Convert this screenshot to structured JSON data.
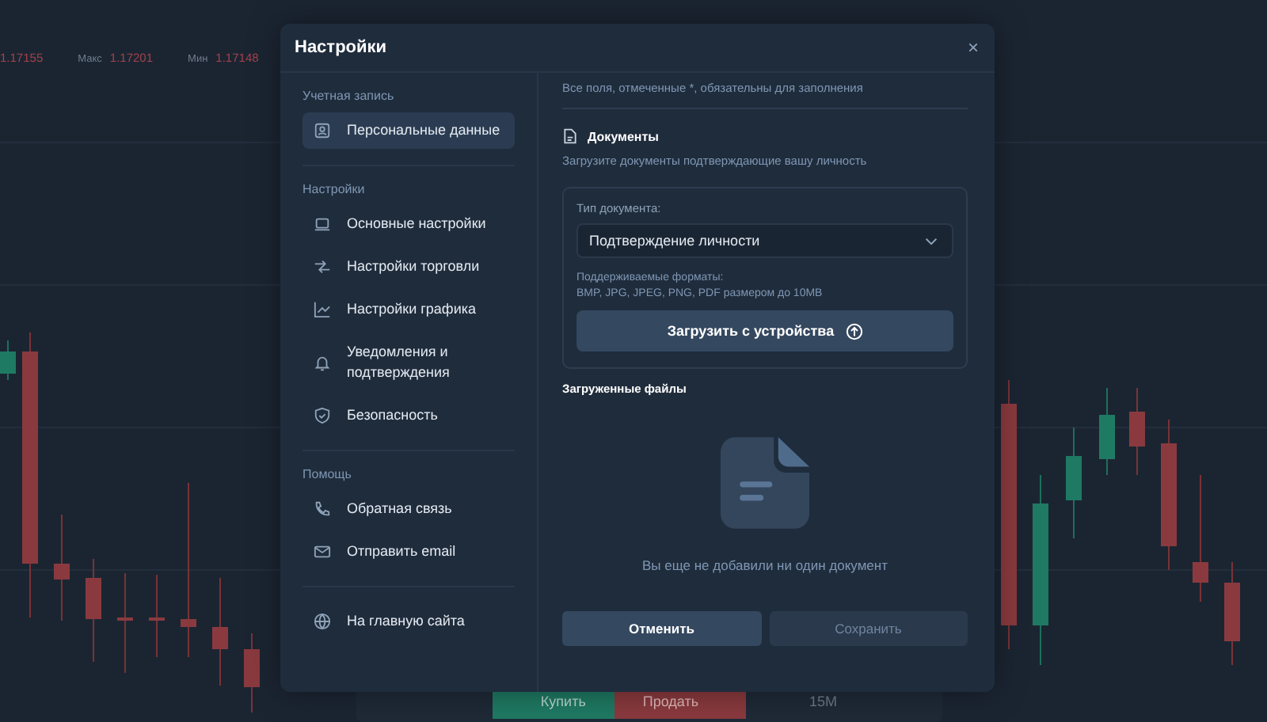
{
  "chart_header": {
    "stats": [
      {
        "value": "1.17155"
      },
      {
        "label": "Макс",
        "value": "1.17201"
      },
      {
        "label": "Мин",
        "value": "1.17148"
      }
    ]
  },
  "trade_bar": {
    "buy": "Купить",
    "sell": "Продать",
    "timeframe": "15М"
  },
  "window": {
    "title": "Настройки",
    "close": "×"
  },
  "sidebar": {
    "sections": [
      {
        "title": "Учетная запись",
        "items": [
          {
            "label": "Персональные данные",
            "selected": true
          }
        ]
      },
      {
        "title": "Настройки",
        "items": [
          {
            "label": "Основные настройки",
            "selected": false
          },
          {
            "label": "Настройки торговли",
            "selected": false
          },
          {
            "label": "Настройки графика",
            "selected": false
          },
          {
            "label": "Уведомления и подтверждения",
            "selected": false
          },
          {
            "label": "Безопасность",
            "selected": false
          }
        ]
      },
      {
        "title": "Помощь",
        "items": [
          {
            "label": "Обратная связь",
            "selected": false
          },
          {
            "label": "Отправить email",
            "selected": false
          }
        ]
      },
      {
        "items": [
          {
            "label": "На главную сайта",
            "selected": false
          }
        ]
      }
    ]
  },
  "content": {
    "note": "Все поля, отмеченные *, обязательны для заполнения",
    "documents": {
      "title": "Документы",
      "subtitle": "Загрузите документы подтверждающие вашу личность",
      "doc_type": {
        "label": "Тип документа:",
        "value": "Подтверждение личности"
      },
      "formats": [
        "Поддерживаемые форматы:",
        "BMP, JPG, JPEG, PNG, PDF размером до 10MB"
      ],
      "upload_button": "Загрузить с устройства"
    },
    "uploaded": {
      "title": "Загруженные файлы",
      "empty_text": "Вы еще не добавили ни один документ"
    },
    "buttons": [
      {
        "label": "Отменить",
        "disabled": false
      },
      {
        "label": "Сохранить",
        "disabled": true
      }
    ]
  }
}
